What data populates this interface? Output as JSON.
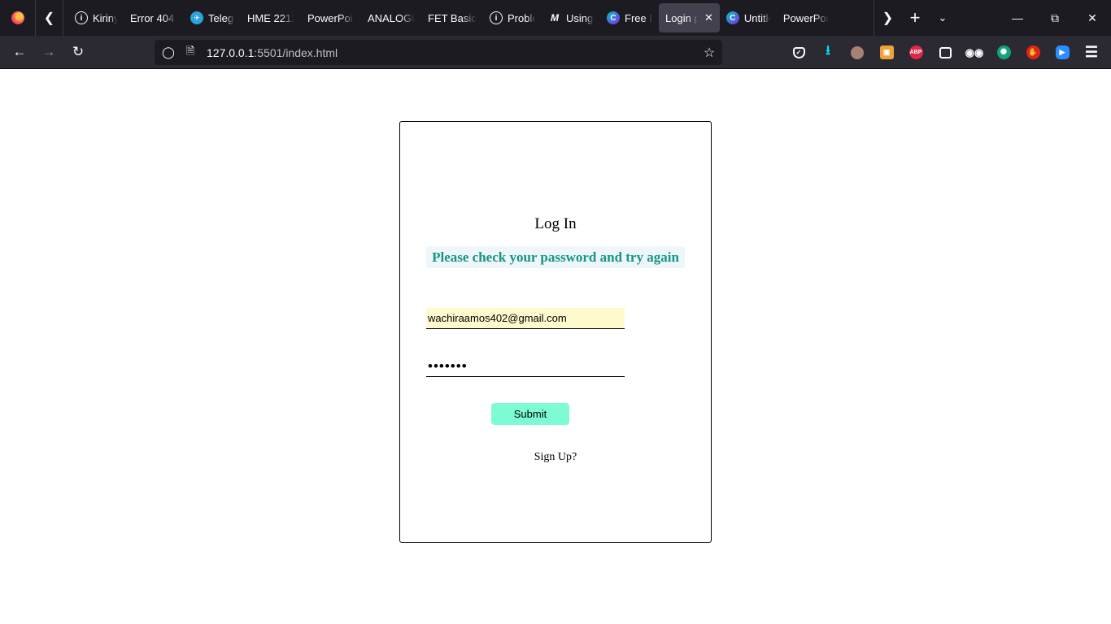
{
  "browser": {
    "tabs": [
      {
        "label": "Kiriny",
        "icon": "info-icon"
      },
      {
        "label": "Error 404 (",
        "icon": "none"
      },
      {
        "label": "Telegr",
        "icon": "telegram-icon"
      },
      {
        "label": "HME 2212",
        "icon": "none"
      },
      {
        "label": "PowerPoi",
        "icon": "none"
      },
      {
        "label": "ANALOGU",
        "icon": "none"
      },
      {
        "label": "FET Basics",
        "icon": "none"
      },
      {
        "label": "Proble",
        "icon": "info-icon"
      },
      {
        "label": "Using",
        "icon": "medium-icon"
      },
      {
        "label": "Free D",
        "icon": "canva-icon"
      },
      {
        "label": "Login p",
        "icon": "none",
        "active": true
      },
      {
        "label": "Untitle",
        "icon": "canva-icon"
      },
      {
        "label": "PowerPoi",
        "icon": "none"
      }
    ],
    "url": {
      "host": "127.0.0.1",
      "path": ":5501/index.html"
    }
  },
  "login": {
    "title": "Log In",
    "error_message": "Please check your password and try again",
    "email_value": "wachiraamos402@gmail.com",
    "password_value": "•••••••",
    "submit_label": "Submit",
    "signup_label": "Sign Up?"
  },
  "colors": {
    "error_text": "#159582",
    "submit_bg": "#7dfbd4",
    "email_autofill_bg": "#fffacd"
  }
}
